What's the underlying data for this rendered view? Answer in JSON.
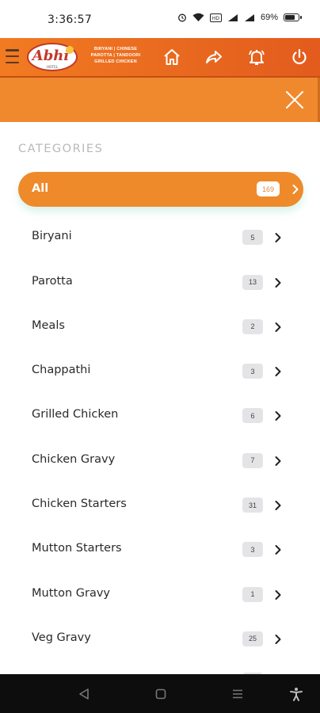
{
  "status_bar": {
    "time": "3:36:57",
    "battery": "69%",
    "icons": [
      "alarm-icon",
      "wifi-icon",
      "volte-icon",
      "signal-icon",
      "signal-icon",
      "battery-icon"
    ]
  },
  "header": {
    "logo_text": "Abhi",
    "logo_sub": "HOTEL",
    "tagline_lines": [
      "BIRYANI | CHINESE",
      "PAROTTA | TANDOORI",
      "GRILLED CHICKEN"
    ],
    "buttons": [
      "home-icon",
      "share-icon",
      "bell-icon",
      "power-icon"
    ]
  },
  "categories": {
    "title": "CATEGORIES",
    "items": [
      {
        "label": "All",
        "count": "169",
        "active": true
      },
      {
        "label": "Biryani",
        "count": "5"
      },
      {
        "label": "Parotta",
        "count": "13"
      },
      {
        "label": "Meals",
        "count": "2"
      },
      {
        "label": "Chappathi",
        "count": "3"
      },
      {
        "label": "Grilled Chicken",
        "count": "6"
      },
      {
        "label": "Chicken Gravy",
        "count": "7"
      },
      {
        "label": "Chicken Starters",
        "count": "31"
      },
      {
        "label": "Mutton Starters",
        "count": "3"
      },
      {
        "label": "Mutton Gravy",
        "count": "1"
      },
      {
        "label": "Veg Gravy",
        "count": "25"
      }
    ]
  },
  "colors": {
    "brand_orange": "#f0892e",
    "header_orange": "#e8681f",
    "active_pill": "#ef8a2a",
    "badge_bg": "#e4e4e7"
  }
}
